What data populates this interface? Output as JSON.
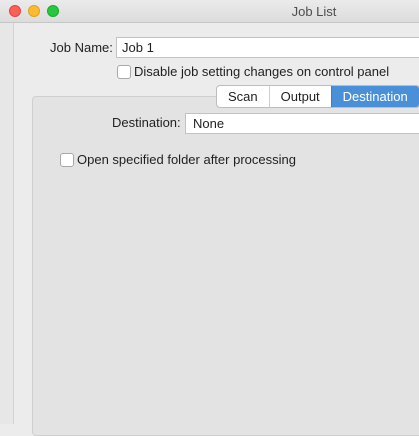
{
  "window": {
    "title": "Job List"
  },
  "form": {
    "job_name_label": "Job Name:",
    "job_name_value": "Job 1",
    "disable_changes_label": "Disable job setting changes on control panel",
    "disable_changes_checked": false
  },
  "tabs": [
    {
      "label": "Scan",
      "selected": false
    },
    {
      "label": "Output",
      "selected": false
    },
    {
      "label": "Destination",
      "selected": true
    }
  ],
  "destination": {
    "label": "Destination:",
    "value": "None",
    "open_folder_label": "Open specified folder after processing",
    "open_folder_checked": false
  },
  "colors": {
    "accent": "#4a90d9"
  }
}
